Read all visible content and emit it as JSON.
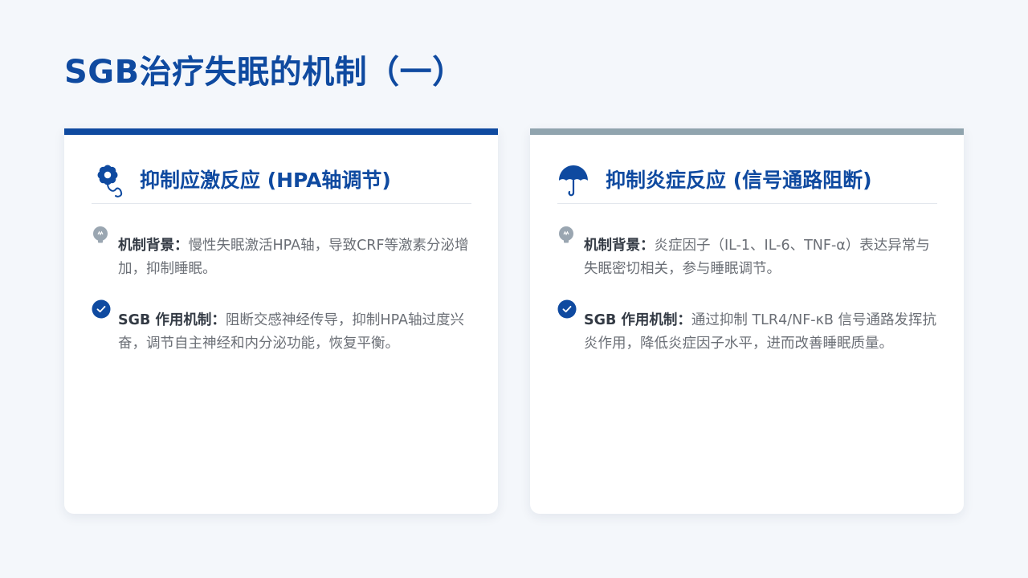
{
  "slide": {
    "title": "SGB治疗失眠的机制（一）"
  },
  "cards": [
    {
      "icon": "flower-icon",
      "accent": "#0f4aa0",
      "title": "抑制应激反应 (HPA轴调节)",
      "items": [
        {
          "icon": "lightbulb-icon",
          "label": "机制背景：",
          "text": "慢性失眠激活HPA轴，导致CRF等激素分泌增加，抑制睡眠。"
        },
        {
          "icon": "check-circle-icon",
          "label": "SGB 作用机制：",
          "text": "阻断交感神经传导，抑制HPA轴过度兴奋，调节自主神经和内分泌功能，恢复平衡。"
        }
      ]
    },
    {
      "icon": "umbrella-icon",
      "accent": "#90a4ae",
      "title": "抑制炎症反应 (信号通路阻断)",
      "items": [
        {
          "icon": "lightbulb-icon",
          "label": "机制背景：",
          "text": "炎症因子（IL-1、IL-6、TNF-α）表达异常与失眠密切相关，参与睡眠调节。"
        },
        {
          "icon": "check-circle-icon",
          "label": "SGB 作用机制：",
          "text": "通过抑制 TLR4/NF-κB 信号通路发挥抗炎作用，降低炎症因子水平，进而改善睡眠质量。"
        }
      ]
    }
  ],
  "colors": {
    "title": "#0f4aa0",
    "background": "#f4f7fb",
    "card": "#ffffff",
    "bulb": "#9aa6b1",
    "check": "#0f4aa0"
  }
}
